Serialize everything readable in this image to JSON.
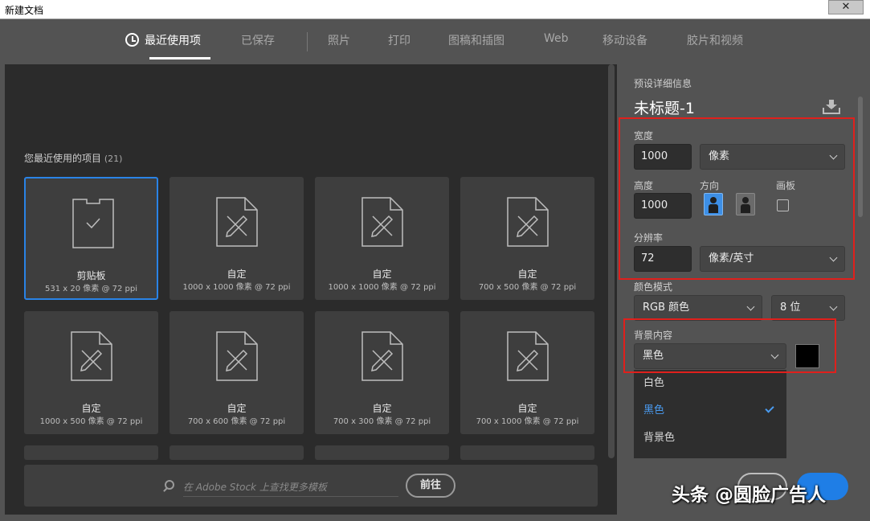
{
  "window": {
    "title": "新建文档",
    "close_glyph": "✕"
  },
  "tabs": [
    {
      "label": "最近使用项"
    },
    {
      "label": "已保存"
    },
    {
      "label": "照片"
    },
    {
      "label": "打印"
    },
    {
      "label": "图稿和插图"
    },
    {
      "label": "Web"
    },
    {
      "label": "移动设备"
    },
    {
      "label": "胶片和视频"
    }
  ],
  "recent": {
    "label": "您最近使用的项目",
    "count": "(21)",
    "items": [
      {
        "name": "剪贴板",
        "dims": "531 x 20 像素 @ 72 ppi"
      },
      {
        "name": "自定",
        "dims": "1000 x 1000 像素 @ 72 ppi"
      },
      {
        "name": "自定",
        "dims": "1000 x 1000 像素 @ 72 ppi"
      },
      {
        "name": "自定",
        "dims": "700 x 500 像素 @ 72 ppi"
      },
      {
        "name": "自定",
        "dims": "1000 x 500 像素 @ 72 ppi"
      },
      {
        "name": "自定",
        "dims": "700 x 600 像素 @ 72 ppi"
      },
      {
        "name": "自定",
        "dims": "700 x 300 像素 @ 72 ppi"
      },
      {
        "name": "自定",
        "dims": "700 x 1000 像素 @ 72 ppi"
      }
    ]
  },
  "stock": {
    "placeholder": "在 Adobe Stock 上查找更多模板",
    "go_label": "前往"
  },
  "preset": {
    "header": "预设详细信息",
    "doc_title": "未标题-1",
    "width_label": "宽度",
    "width_value": "1000",
    "width_unit": "像素",
    "height_label": "高度",
    "height_value": "1000",
    "orientation_label": "方向",
    "artboard_label": "画板",
    "resolution_label": "分辨率",
    "resolution_value": "72",
    "resolution_unit": "像素/英寸",
    "color_mode_label": "颜色模式",
    "color_mode_value": "RGB 颜色",
    "bit_depth_value": "8 位",
    "bg_label": "背景内容",
    "bg_value": "黑色",
    "bg_swatch_color": "#000000",
    "bg_options": [
      "白色",
      "黑色",
      "背景色"
    ],
    "bg_selected_index": 1
  },
  "watermark": "头条 @圆脸广告人",
  "colors": {
    "accent": "#2a83e6",
    "highlight_box": "#e0201c"
  }
}
